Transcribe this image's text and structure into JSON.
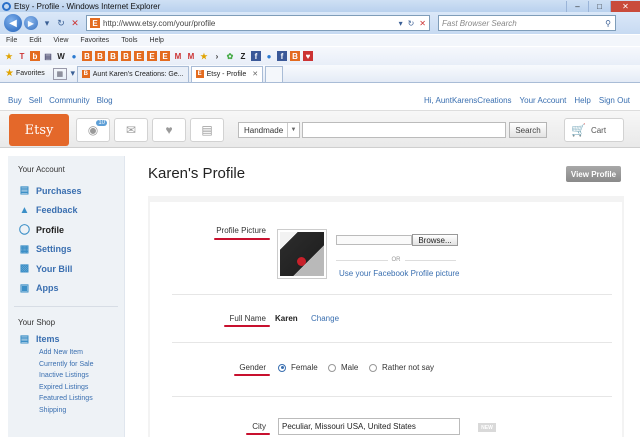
{
  "browser": {
    "title": "Etsy - Profile - Windows Internet Explorer",
    "url": "http://www.etsy.com/your/profile",
    "search_placeholder": "Fast Browser Search",
    "menu": [
      "File",
      "Edit",
      "View",
      "Favorites",
      "Tools",
      "Help"
    ],
    "favorites_label": "Favorites",
    "tabs": [
      {
        "label": "Aunt Karen's Creations: Ge...",
        "active": false
      },
      {
        "label": "Etsy - Profile",
        "active": true
      }
    ],
    "links_icons": [
      "w-icon",
      "t-icon",
      "e-icon",
      "b-icon",
      "gmail-icon",
      "star-icon",
      "facebook-icon",
      "globe-icon",
      "heart-icon"
    ]
  },
  "etsy": {
    "topnav_left": [
      "Buy",
      "Sell",
      "Community",
      "Blog"
    ],
    "topnav_right": [
      "Hi, AuntKarensCreations",
      "Your Account",
      "Help",
      "Sign Out"
    ],
    "logo": "Etsy",
    "notification_count": "10",
    "search_scope": "Handmade",
    "search_button": "Search",
    "cart_label": "Cart",
    "sidebar": {
      "account_title": "Your Account",
      "account_items": [
        {
          "label": "Purchases",
          "icon": "purchases-icon"
        },
        {
          "label": "Feedback",
          "icon": "feedback-icon"
        },
        {
          "label": "Profile",
          "icon": "profile-icon",
          "active": true
        },
        {
          "label": "Settings",
          "icon": "settings-icon"
        },
        {
          "label": "Your Bill",
          "icon": "bill-icon"
        },
        {
          "label": "Apps",
          "icon": "apps-icon"
        }
      ],
      "shop_title": "Your Shop",
      "items_label": "Items",
      "item_links": [
        "Add New Item",
        "Currently for Sale",
        "Inactive Listings",
        "Expired Listings",
        "Featured Listings",
        "Shipping"
      ]
    },
    "page_title": "Karen's Profile",
    "view_profile_button": "View Profile",
    "form": {
      "profile_picture_label": "Profile Picture",
      "browse_button": "Browse...",
      "or_text": "OR",
      "facebook_link": "Use your Facebook Profile picture",
      "full_name_label": "Full Name",
      "full_name_value": "Karen",
      "change_link": "Change",
      "gender_label": "Gender",
      "gender_options": [
        "Female",
        "Male",
        "Rather not say"
      ],
      "gender_selected": "Female",
      "city_label": "City",
      "city_value": "Peculiar, Missouri  USA, United States",
      "new_badge": "NEW"
    }
  }
}
